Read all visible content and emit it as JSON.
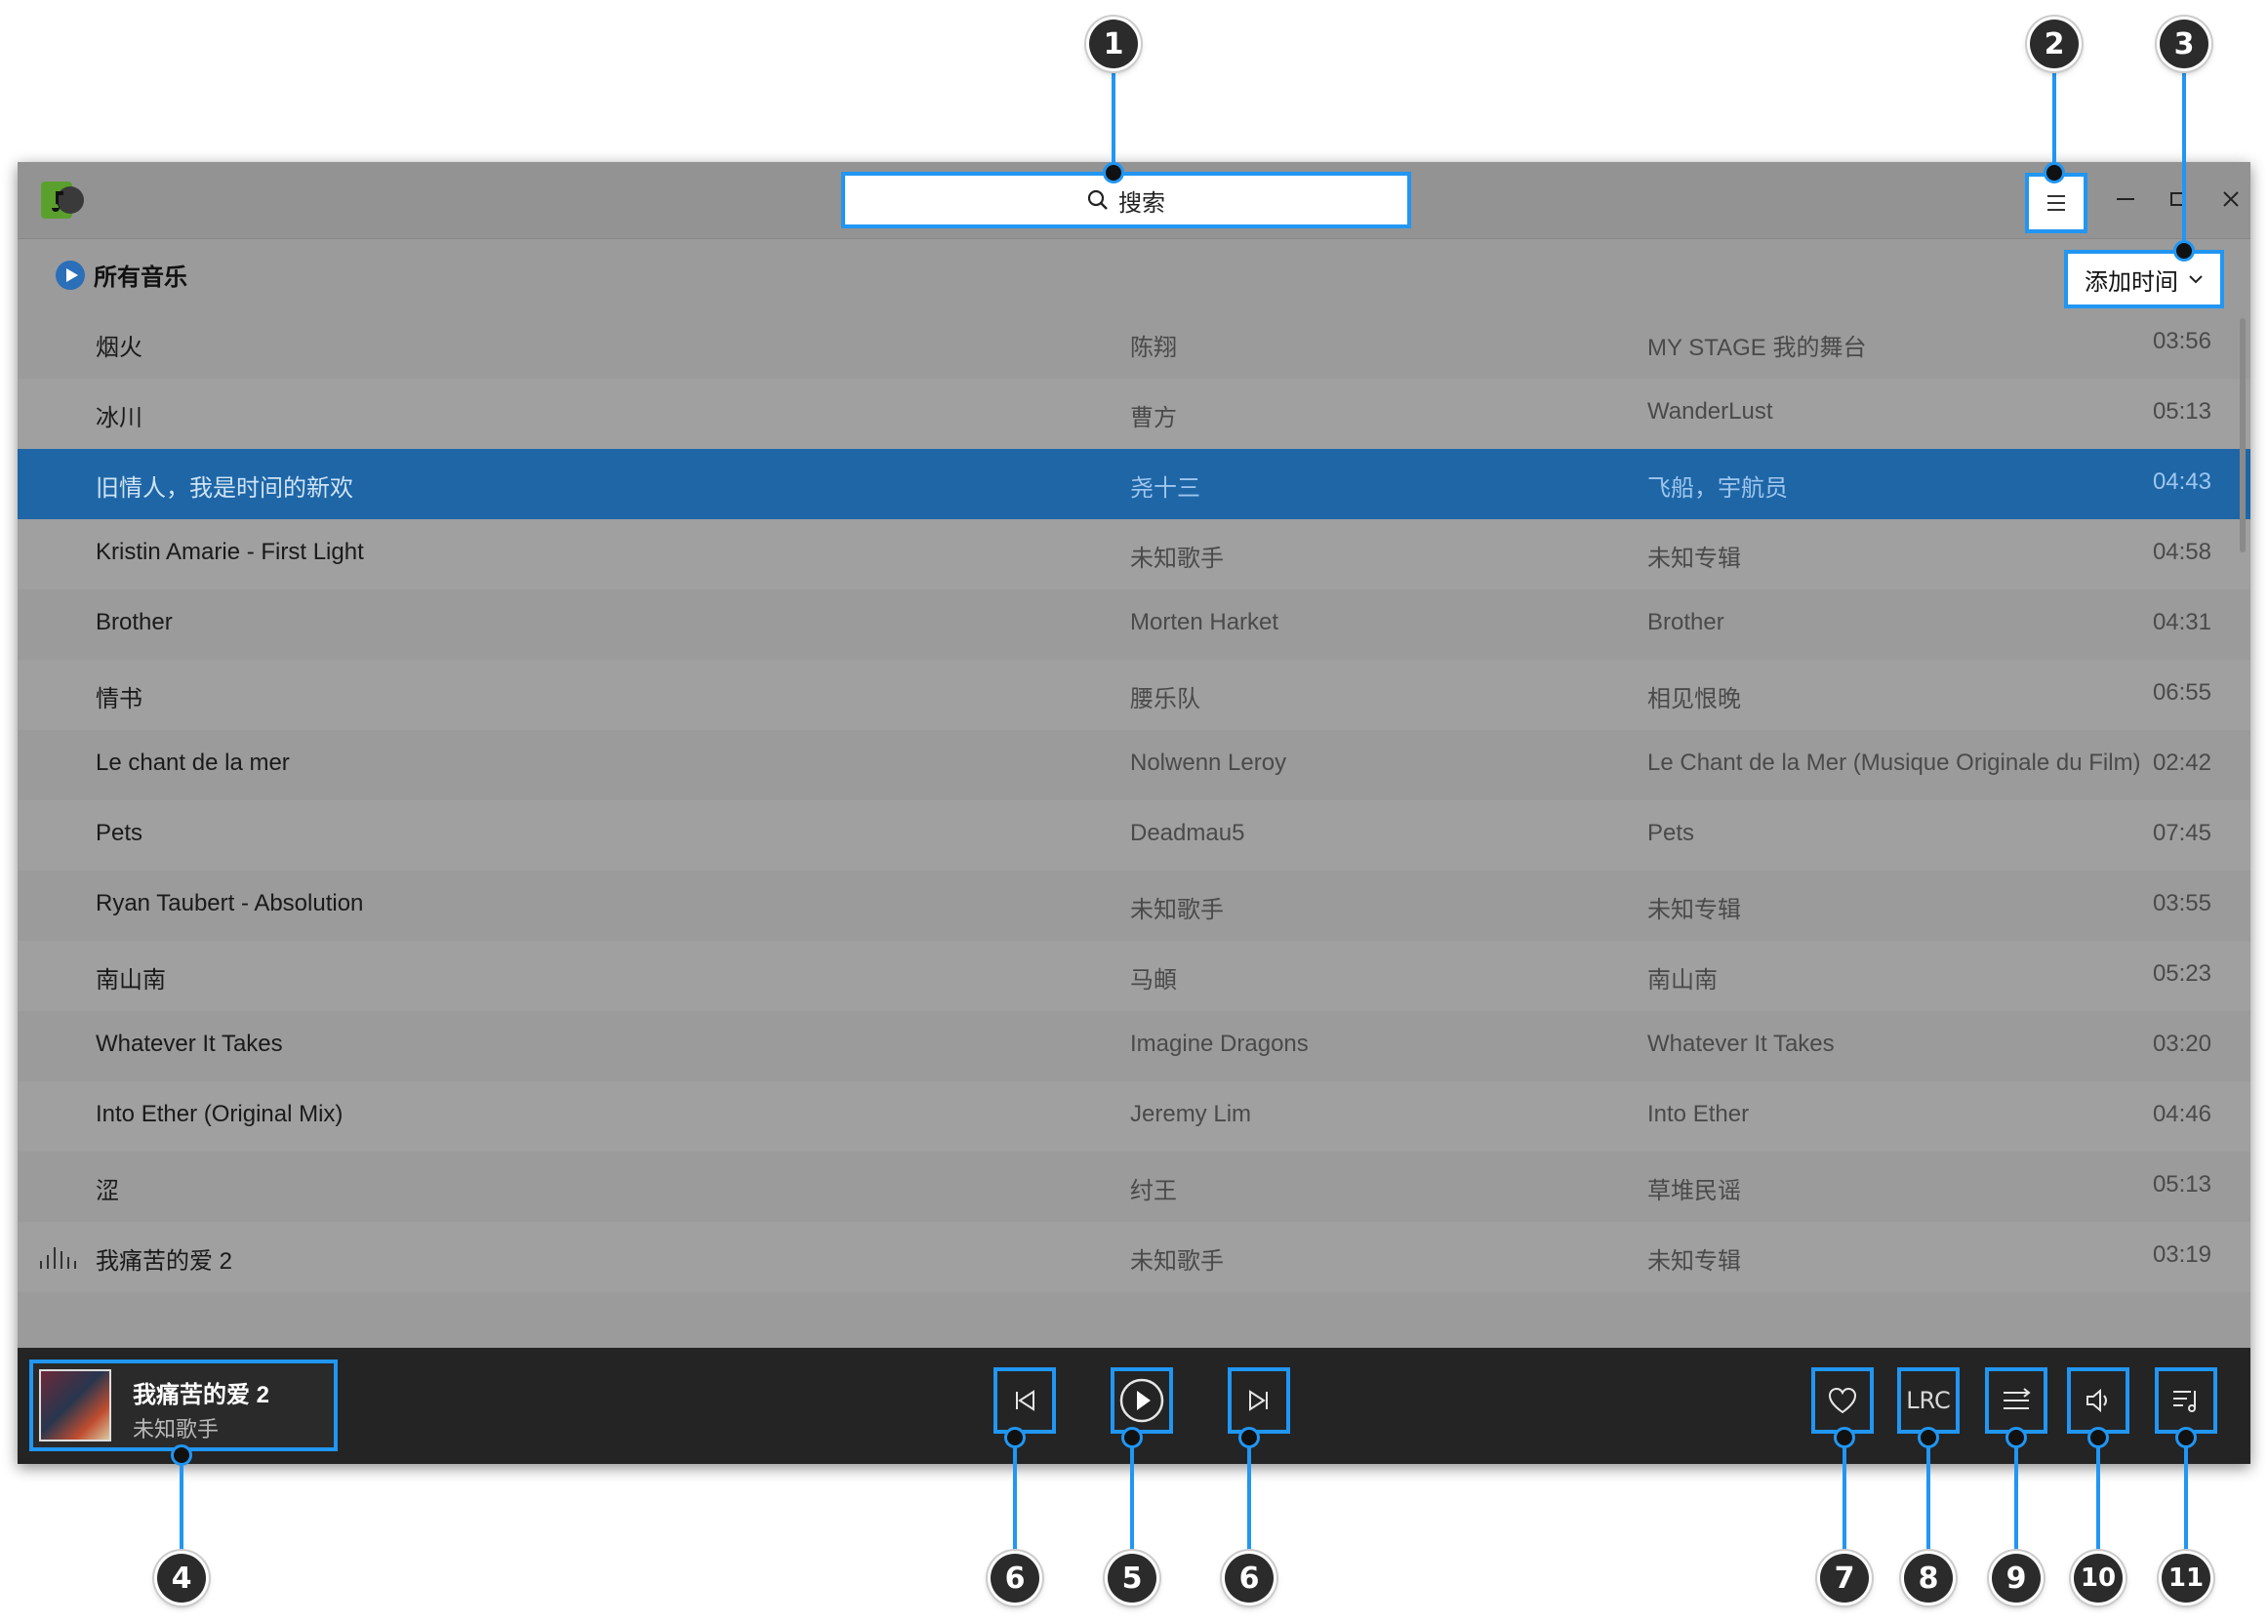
{
  "window": {
    "search_placeholder": "搜索",
    "header_title": "所有音乐",
    "sort_label": "添加时间",
    "icons": {
      "logo": "music-note-icon",
      "menu": "hamburger-icon",
      "minimize": "minimize-icon",
      "maximize": "maximize-icon",
      "close": "close-icon",
      "play_circle": "play-circle-icon",
      "equalizer": "equalizer-icon"
    }
  },
  "tracks": [
    {
      "title": "烟火",
      "artist": "陈翔",
      "album": "MY STAGE 我的舞台",
      "duration": "03:56"
    },
    {
      "title": "冰川",
      "artist": "曹方",
      "album": "WanderLust",
      "duration": "05:13"
    },
    {
      "title": "旧情人，我是时间的新欢",
      "artist": "尧十三",
      "album": "飞船，宇航员",
      "duration": "04:43",
      "selected": true
    },
    {
      "title": "Kristin Amarie - First Light",
      "artist": "未知歌手",
      "album": "未知专辑",
      "duration": "04:58"
    },
    {
      "title": "Brother",
      "artist": "Morten Harket",
      "album": "Brother",
      "duration": "04:31"
    },
    {
      "title": "情书",
      "artist": "腰乐队",
      "album": "相见恨晚",
      "duration": "06:55"
    },
    {
      "title": "Le chant de la mer",
      "artist": "Nolwenn Leroy",
      "album": "Le Chant de la Mer (Musique Originale du Film)",
      "duration": "02:42"
    },
    {
      "title": "Pets",
      "artist": "Deadmau5",
      "album": "Pets",
      "duration": "07:45"
    },
    {
      "title": "Ryan Taubert - Absolution",
      "artist": "未知歌手",
      "album": "未知专辑",
      "duration": "03:55"
    },
    {
      "title": "南山南",
      "artist": "马頔",
      "album": "南山南",
      "duration": "05:23"
    },
    {
      "title": "Whatever It Takes",
      "artist": "Imagine Dragons",
      "album": "Whatever It Takes",
      "duration": "03:20"
    },
    {
      "title": "Into Ether (Original Mix)",
      "artist": "Jeremy Lim",
      "album": "Into Ether",
      "duration": "04:46"
    },
    {
      "title": "涩",
      "artist": "纣王",
      "album": "草堆民谣",
      "duration": "05:13"
    },
    {
      "title": "我痛苦的爱 2",
      "artist": "未知歌手",
      "album": "未知专辑",
      "duration": "03:19",
      "playing": true
    }
  ],
  "player": {
    "now_title": "我痛苦的爱 2",
    "now_artist": "未知歌手",
    "lrc_label": "LRC",
    "icons": {
      "prev": "skip-previous-icon",
      "play": "play-icon",
      "next": "skip-next-icon",
      "favorite": "heart-icon",
      "lyrics": "lrc-icon",
      "mode": "play-mode-icon",
      "volume": "volume-icon",
      "playlist": "playlist-icon"
    }
  },
  "callouts": [
    "1",
    "2",
    "3",
    "4",
    "5",
    "6",
    "6",
    "7",
    "8",
    "9",
    "10",
    "11"
  ],
  "colors": {
    "accent": "#2196f3",
    "selected_row": "#1e66a6",
    "window_bg": "#9b9b9b",
    "player_bg": "#242424"
  }
}
